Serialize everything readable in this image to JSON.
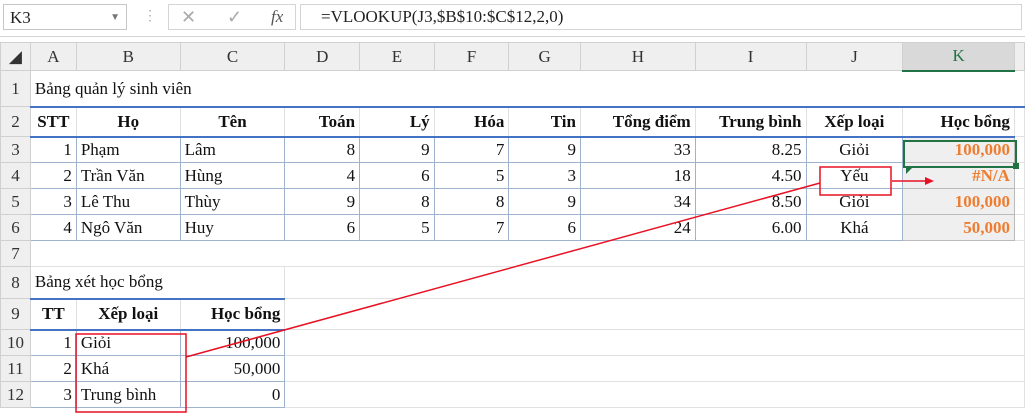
{
  "formula_bar": {
    "name_box": "K3",
    "cancel_icon": "✕",
    "enter_icon": "✓",
    "fx": "fx",
    "formula": "=VLOOKUP(J3,$B$10:$C$12,2,0)"
  },
  "columns": [
    "A",
    "B",
    "C",
    "D",
    "E",
    "F",
    "G",
    "H",
    "I",
    "J",
    "K"
  ],
  "rows": [
    "1",
    "2",
    "3",
    "4",
    "5",
    "6",
    "7",
    "8",
    "9",
    "10",
    "11",
    "12"
  ],
  "title1": "Bảng quản lý sinh viên",
  "headers1": [
    "STT",
    "Họ",
    "Tên",
    "Toán",
    "Lý",
    "Hóa",
    "Tin",
    "Tổng điểm",
    "Trung bình",
    "Xếp loại",
    "Học bổng"
  ],
  "students": [
    [
      "1",
      "Phạm",
      "Lâm",
      "8",
      "9",
      "7",
      "9",
      "33",
      "8.25",
      "Giỏi",
      "100,000"
    ],
    [
      "2",
      "Trần Văn",
      "Hùng",
      "4",
      "6",
      "5",
      "3",
      "18",
      "4.50",
      "Yếu",
      "#N/A"
    ],
    [
      "3",
      "Lê Thu",
      "Thùy",
      "9",
      "8",
      "8",
      "9",
      "34",
      "8.50",
      "Giỏi",
      "100,000"
    ],
    [
      "4",
      "Ngô Văn",
      "Huy",
      "6",
      "5",
      "7",
      "6",
      "24",
      "6.00",
      "Khá",
      "50,000"
    ]
  ],
  "title2": "Bảng xét học bổng",
  "headers2": [
    "TT",
    "Xếp loại",
    "Học bổng"
  ],
  "scholarships": [
    [
      "1",
      "Giỏi",
      "100,000"
    ],
    [
      "2",
      "Khá",
      "50,000"
    ],
    [
      "3",
      "Trung bình",
      "0"
    ]
  ],
  "colors": {
    "selected": "#217346",
    "result": "#ed7d31",
    "annotation": "#e81123"
  }
}
